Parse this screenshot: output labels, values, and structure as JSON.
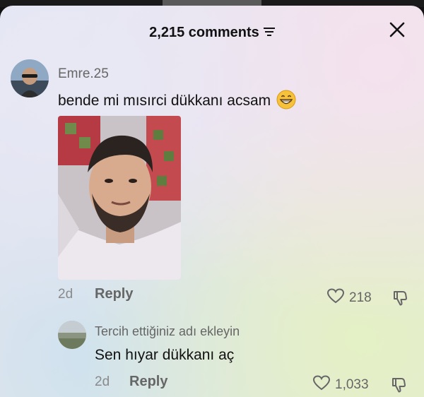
{
  "header": {
    "title": "2,215 comments"
  },
  "comments": [
    {
      "username": "Emre.25",
      "text": "bende mi mısırci dükkanı acsam",
      "date": "2d",
      "reply_label": "Reply",
      "likes": "218"
    },
    {
      "username": "Tercih ettiğiniz adı ekleyin",
      "text": "Sen hıyar dükkanı aç",
      "date": "2d",
      "reply_label": "Reply",
      "likes": "1,033"
    }
  ],
  "colors": {
    "text": "#111111",
    "muted": "#666666",
    "meta": "#8a8a8a"
  },
  "icons": [
    "sort-icon",
    "close-icon",
    "grinning-emoji-icon",
    "heart-icon",
    "dislike-icon"
  ]
}
